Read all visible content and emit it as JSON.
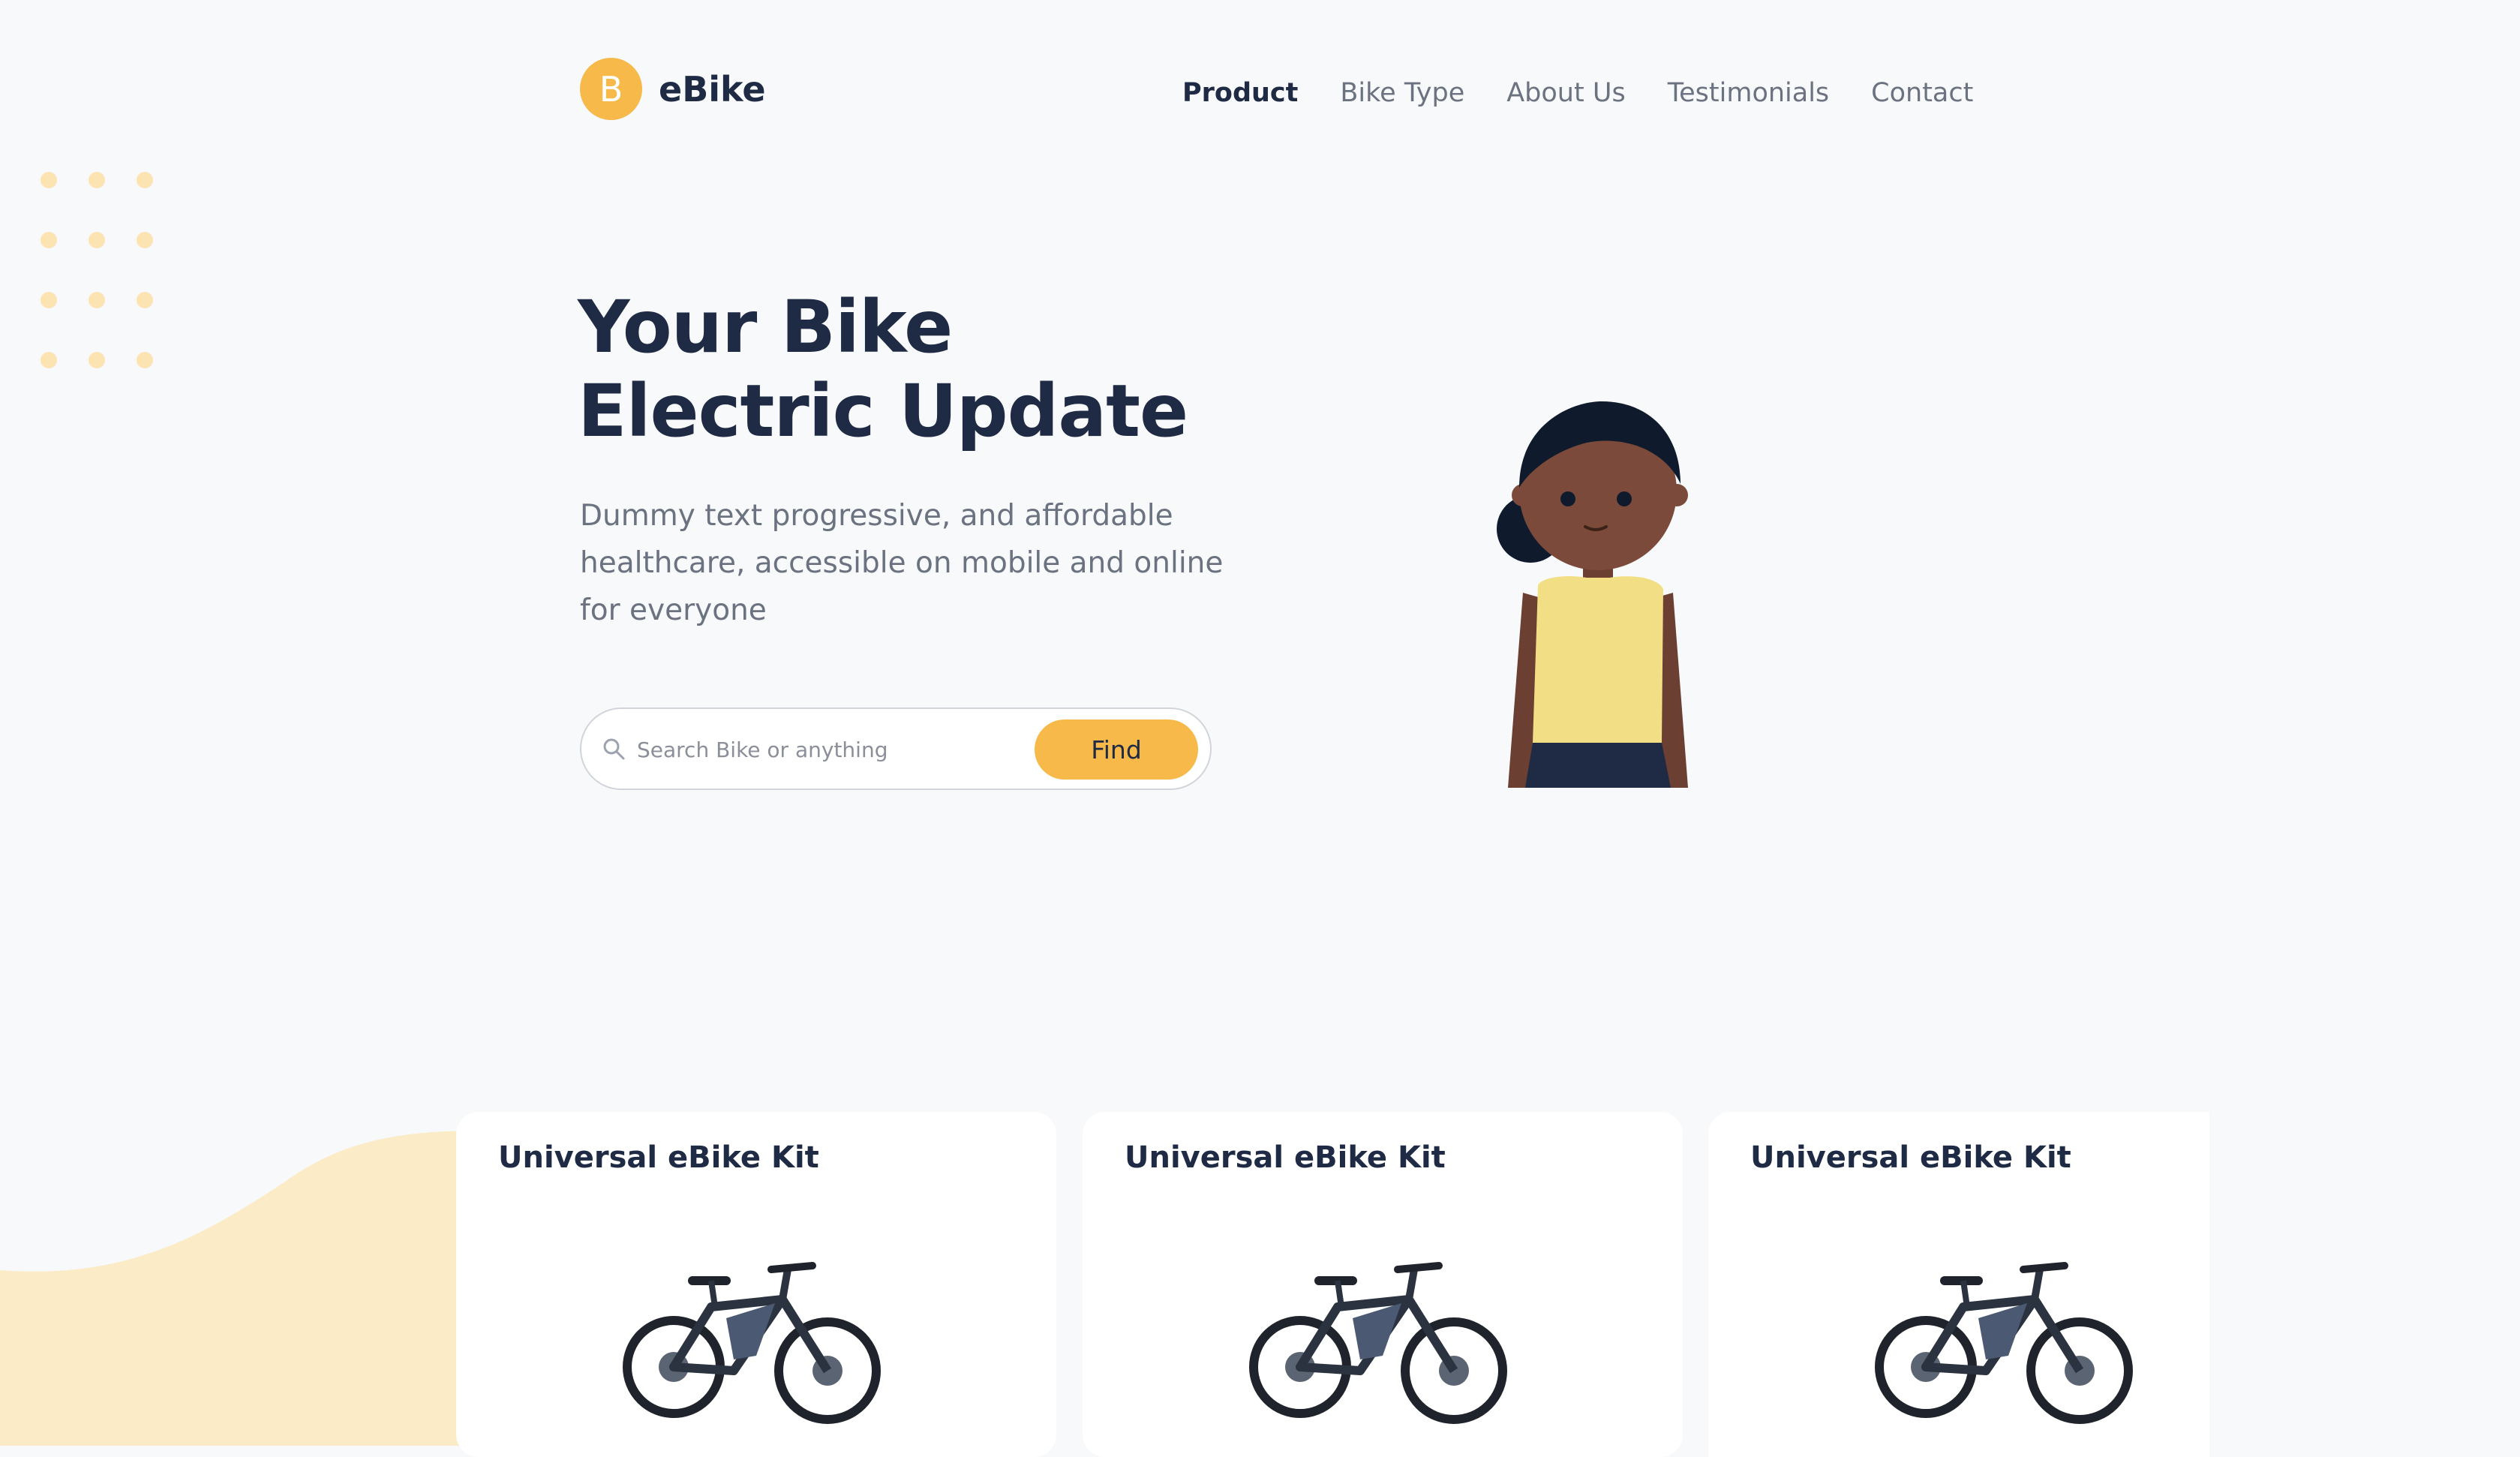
{
  "header": {
    "logo_letter": "B",
    "logo_text": "eBike",
    "nav": [
      {
        "label": "Product"
      },
      {
        "label": "Bike Type"
      },
      {
        "label": "About Us"
      },
      {
        "label": "Testimonials"
      },
      {
        "label": "Contact"
      }
    ]
  },
  "hero": {
    "title_line1": "Your Bike",
    "title_line2": "Electric Update",
    "description": "Dummy text progressive, and affordable healthcare, accessible on mobile and online for everyone",
    "search": {
      "placeholder": "Search Bike or anything",
      "value": "",
      "button_label": "Find"
    }
  },
  "products": [
    {
      "title": "Universal eBike Kit"
    },
    {
      "title": "Universal eBike Kit"
    },
    {
      "title": "Universal eBike Kit"
    }
  ],
  "colors": {
    "accent": "#f6b94a",
    "text_dark": "#1f2a44",
    "text_muted": "#6b7280",
    "background": "#f8f9fb"
  },
  "icons": {
    "logo": "b-letter-badge",
    "search": "search-icon"
  }
}
